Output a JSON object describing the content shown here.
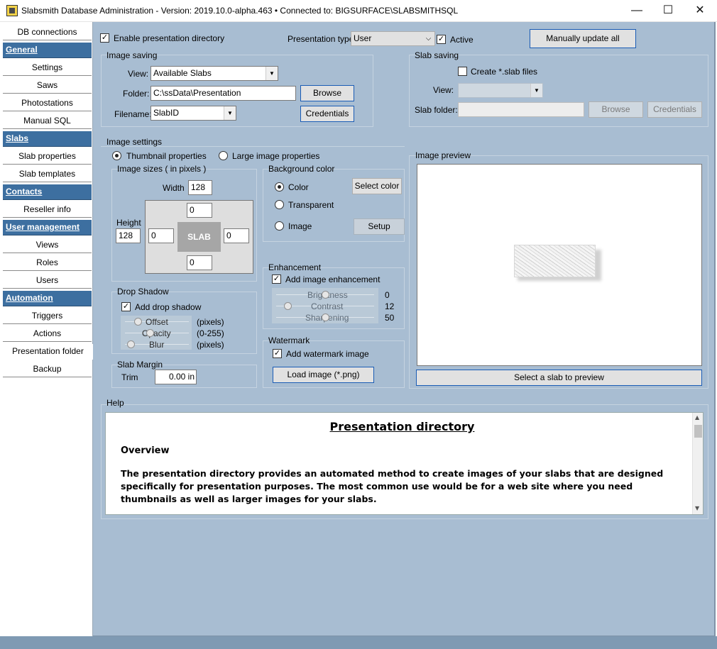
{
  "window": {
    "title": "Slabsmith Database Administration - Version: 2019.10.0-alpha.463 •  Connected to: BIGSURFACE\\SLABSMITHSQL",
    "minimize": "—",
    "maximize": "☐",
    "close": "✕"
  },
  "sidebar": {
    "items": [
      {
        "label": "DB connections"
      },
      {
        "label": "General"
      },
      {
        "label": "Settings"
      },
      {
        "label": "Saws"
      },
      {
        "label": "Photostations"
      },
      {
        "label": "Manual SQL"
      },
      {
        "label": "Slabs"
      },
      {
        "label": "Slab properties"
      },
      {
        "label": "Slab templates"
      },
      {
        "label": "Contacts"
      },
      {
        "label": "Reseller info"
      },
      {
        "label": "User management"
      },
      {
        "label": "Views"
      },
      {
        "label": "Roles"
      },
      {
        "label": "Users"
      },
      {
        "label": "Automation"
      },
      {
        "label": "Triggers"
      },
      {
        "label": "Actions"
      },
      {
        "label": "Presentation folder"
      },
      {
        "label": "Backup"
      }
    ]
  },
  "top": {
    "enable_label": "Enable presentation directory",
    "enable_checked": true,
    "type_label": "Presentation type:",
    "type_value": "User",
    "active_label": "Active",
    "active_checked": true,
    "manual_update": "Manually update all"
  },
  "image_saving": {
    "title": "Image saving",
    "view_label": "View:",
    "view_value": "Available Slabs",
    "folder_label": "Folder:",
    "folder_value": "C:\\ssData\\Presentation",
    "browse": "Browse",
    "filename_label": "Filename:",
    "filename_value": "SlabID",
    "credentials": "Credentials"
  },
  "slab_saving": {
    "title": "Slab saving",
    "create_label": "Create *.slab files",
    "create_checked": false,
    "view_label": "View:",
    "folder_label": "Slab folder:",
    "browse": "Browse",
    "credentials": "Credentials"
  },
  "image_settings": {
    "title": "Image settings",
    "thumb_label": "Thumbnail properties",
    "large_label": "Large image properties",
    "sizes_title": "Image sizes ( in pixels )",
    "width_label": "Width",
    "width_value": "128",
    "height_label": "Height",
    "height_value": "128",
    "pad_top": "0",
    "pad_left": "0",
    "pad_right": "0",
    "pad_bottom": "0",
    "slab_text": "SLAB"
  },
  "background": {
    "title": "Background color",
    "color_label": "Color",
    "transparent_label": "Transparent",
    "image_label": "Image",
    "select_color": "Select color",
    "setup": "Setup"
  },
  "enhancement": {
    "title": "Enhancement",
    "add_label": "Add image enhancement",
    "add_checked": true,
    "brightness_label": "Brightness",
    "brightness_value": "0",
    "contrast_label": "Contrast",
    "contrast_value": "12",
    "sharpening_label": "Sharpening",
    "sharpening_value": "50"
  },
  "drop_shadow": {
    "title": "Drop Shadow",
    "add_label": "Add drop shadow",
    "add_checked": true,
    "offset_label": "Offset",
    "offset_unit": "(pixels)",
    "opacity_label": "Opacity",
    "opacity_unit": "(0-255)",
    "blur_label": "Blur",
    "blur_unit": "(pixels)"
  },
  "watermark": {
    "title": "Watermark",
    "add_label": "Add watermark image",
    "add_checked": true,
    "load": "Load image (*.png)"
  },
  "slab_margin": {
    "title": "Slab Margin",
    "trim_label": "Trim",
    "trim_value": "0.00 in"
  },
  "preview": {
    "title": "Image preview",
    "select_button": "Select a slab to preview"
  },
  "help": {
    "title": "Help",
    "heading": "Presentation directory",
    "subheading": "Overview",
    "paragraph": "The presentation directory provides an automated method to create images of your slabs that are designed specifically for presentation purposes.  The most common use would be for a web site where you need thumbnails as well as larger images for your slabs."
  }
}
